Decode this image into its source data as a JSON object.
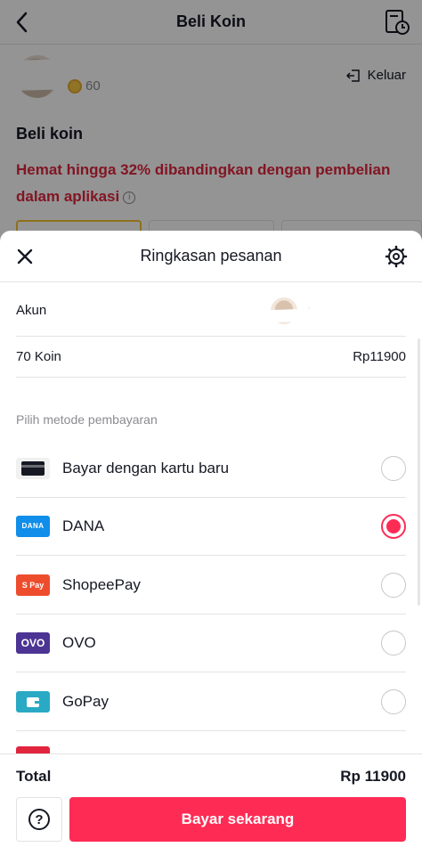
{
  "header": {
    "title": "Beli Koin",
    "back_icon": "back-arrow-icon",
    "history_icon": "history-icon"
  },
  "user": {
    "coins": "60",
    "logout_label": "Keluar"
  },
  "buy": {
    "title": "Beli koin",
    "promo": "Hemat hingga 32% dibandingkan dengan pembelian dalam aplikasi"
  },
  "sheet": {
    "title": "Ringkasan pesanan",
    "account_label": "Akun",
    "quantity_label": "70 Koin",
    "quantity_price": "Rp11900",
    "payment_label": "Pilih metode pembayaran",
    "methods": [
      {
        "name": "Bayar dengan kartu baru",
        "logo_text": "",
        "selected": false
      },
      {
        "name": "DANA",
        "logo_text": "DANA",
        "selected": true
      },
      {
        "name": "ShopeePay",
        "logo_text": "S Pay",
        "selected": false
      },
      {
        "name": "OVO",
        "logo_text": "OVO",
        "selected": false
      },
      {
        "name": "GoPay",
        "logo_text": "",
        "selected": false
      }
    ]
  },
  "footer": {
    "total_label": "Total",
    "total_value": "Rp 11900",
    "pay_button": "Bayar sekarang",
    "help_icon": "help-icon"
  },
  "colors": {
    "accent": "#fe2c55",
    "promo": "#e1253d",
    "dana": "#118ee9",
    "shopeepay": "#ee4d2d",
    "ovo": "#4c3494",
    "gopay": "#2aa9c4"
  }
}
